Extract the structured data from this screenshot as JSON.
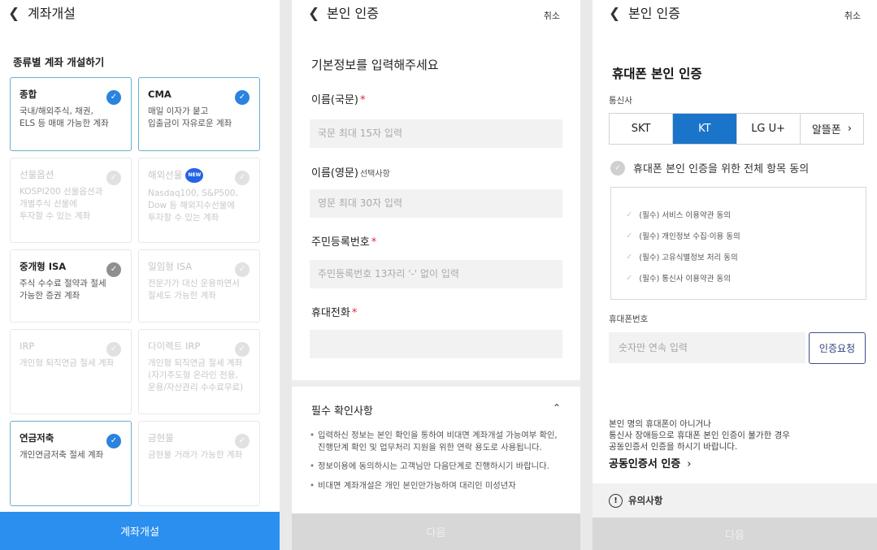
{
  "panel1": {
    "title": "계좌개설",
    "section_title": "종류별 계좌 개설하기",
    "cards": [
      {
        "name": "종합",
        "desc": "국내/해외주식, 채권,\nELS 등 매매 가능한 계좌"
      },
      {
        "name": "CMA",
        "desc": "매일 이자가 붙고\n입출금이 자유로운 계좌"
      },
      {
        "name": "선물옵션",
        "desc": "KOSPI200 선물옵션과\n개별주식 선물에\n투자할 수 있는 계좌"
      },
      {
        "name": "해외선물",
        "badge": "NEW",
        "desc": "Nasdaq100, S&P500,\nDow 등 해외지수선물에\n투자할 수 있는 계좌"
      },
      {
        "name": "중개형 ISA",
        "desc": "주식 수수료 절약과 절세\n가능한 증권 계좌"
      },
      {
        "name": "일임형 ISA",
        "desc": "전문가가 대신 운용하면서\n절세도 가능한 계좌"
      },
      {
        "name": "IRP",
        "desc": "개인형 퇴직연금 절세 계좌"
      },
      {
        "name": "다이렉트 IRP",
        "desc": "개인형 퇴직연금 절세 계좌\n(자기주도형 온라인 전용,\n운용/자산관리 수수료무료)"
      },
      {
        "name": "연금저축",
        "desc": "개인연금저축 절세 계좌"
      },
      {
        "name": "금현물",
        "desc": "금현물 거래가 가능한 계좌"
      }
    ],
    "submit_label": "계좌개설"
  },
  "panel2": {
    "title": "본인 인증",
    "cancel": "취소",
    "heading": "기본정보를 입력해주세요",
    "name_kr_label": "이름(국문)",
    "name_kr_placeholder": "국문 최대 15자 입력",
    "name_en_label": "이름(영문)",
    "name_en_sub": "선택사항",
    "name_en_placeholder": "영문 최대 30자 입력",
    "rrn_label": "주민등록번호",
    "rrn_placeholder": "주민등록번호 13자리 '-' 없이 입력",
    "phone_label": "휴대전화",
    "required_mark": "*",
    "accordion_title": "필수 확인사항",
    "notes": [
      "입력하신 정보는 본인 확인을 통하여 비대면 계좌개설 가능여부 확인, 진행단계 확인 및 업무처리 지원을 위한 연락 용도로 사용됩니다.",
      "정보이용에 동의하시는 고객님만 다음단계로 진행하시기 바랍니다.",
      "비대면 계좌개설은 개인 본인만가능하며 대리인 미성년자"
    ],
    "next_label": "다음"
  },
  "panel3": {
    "title": "본인 인증",
    "cancel": "취소",
    "heading": "휴대폰 본인 인증",
    "carrier_label": "통신사",
    "carriers": [
      "SKT",
      "KT",
      "LG U+",
      "알뜰폰"
    ],
    "agree_all": "휴대폰 본인 인증을 위한 전체 항목 동의",
    "terms": [
      "(필수) 서비스 이용약관 동의",
      "(필수) 개인정보 수집·이용 동의",
      "(필수) 고유식별정보 처리 동의",
      "(필수) 통신사 이용약관 동의"
    ],
    "phone_label": "휴대폰번호",
    "phone_placeholder": "숫자만 연속 입력",
    "verify_label": "인증요청",
    "info_text": "본인 명의 휴대폰이 아니거나\n통신사 장애등으로 휴대폰 본인 인증이 불가한 경우\n공동인증서 인증을 하시기 바랍니다.",
    "cert_link": "공동인증서 인증",
    "notice": "유의사항",
    "next_label": "다음"
  },
  "colors": {
    "primary": "#2b8ff0",
    "check_blue": "#2a83de",
    "carrier_active": "#1a74c9",
    "required": "#e4243c"
  }
}
